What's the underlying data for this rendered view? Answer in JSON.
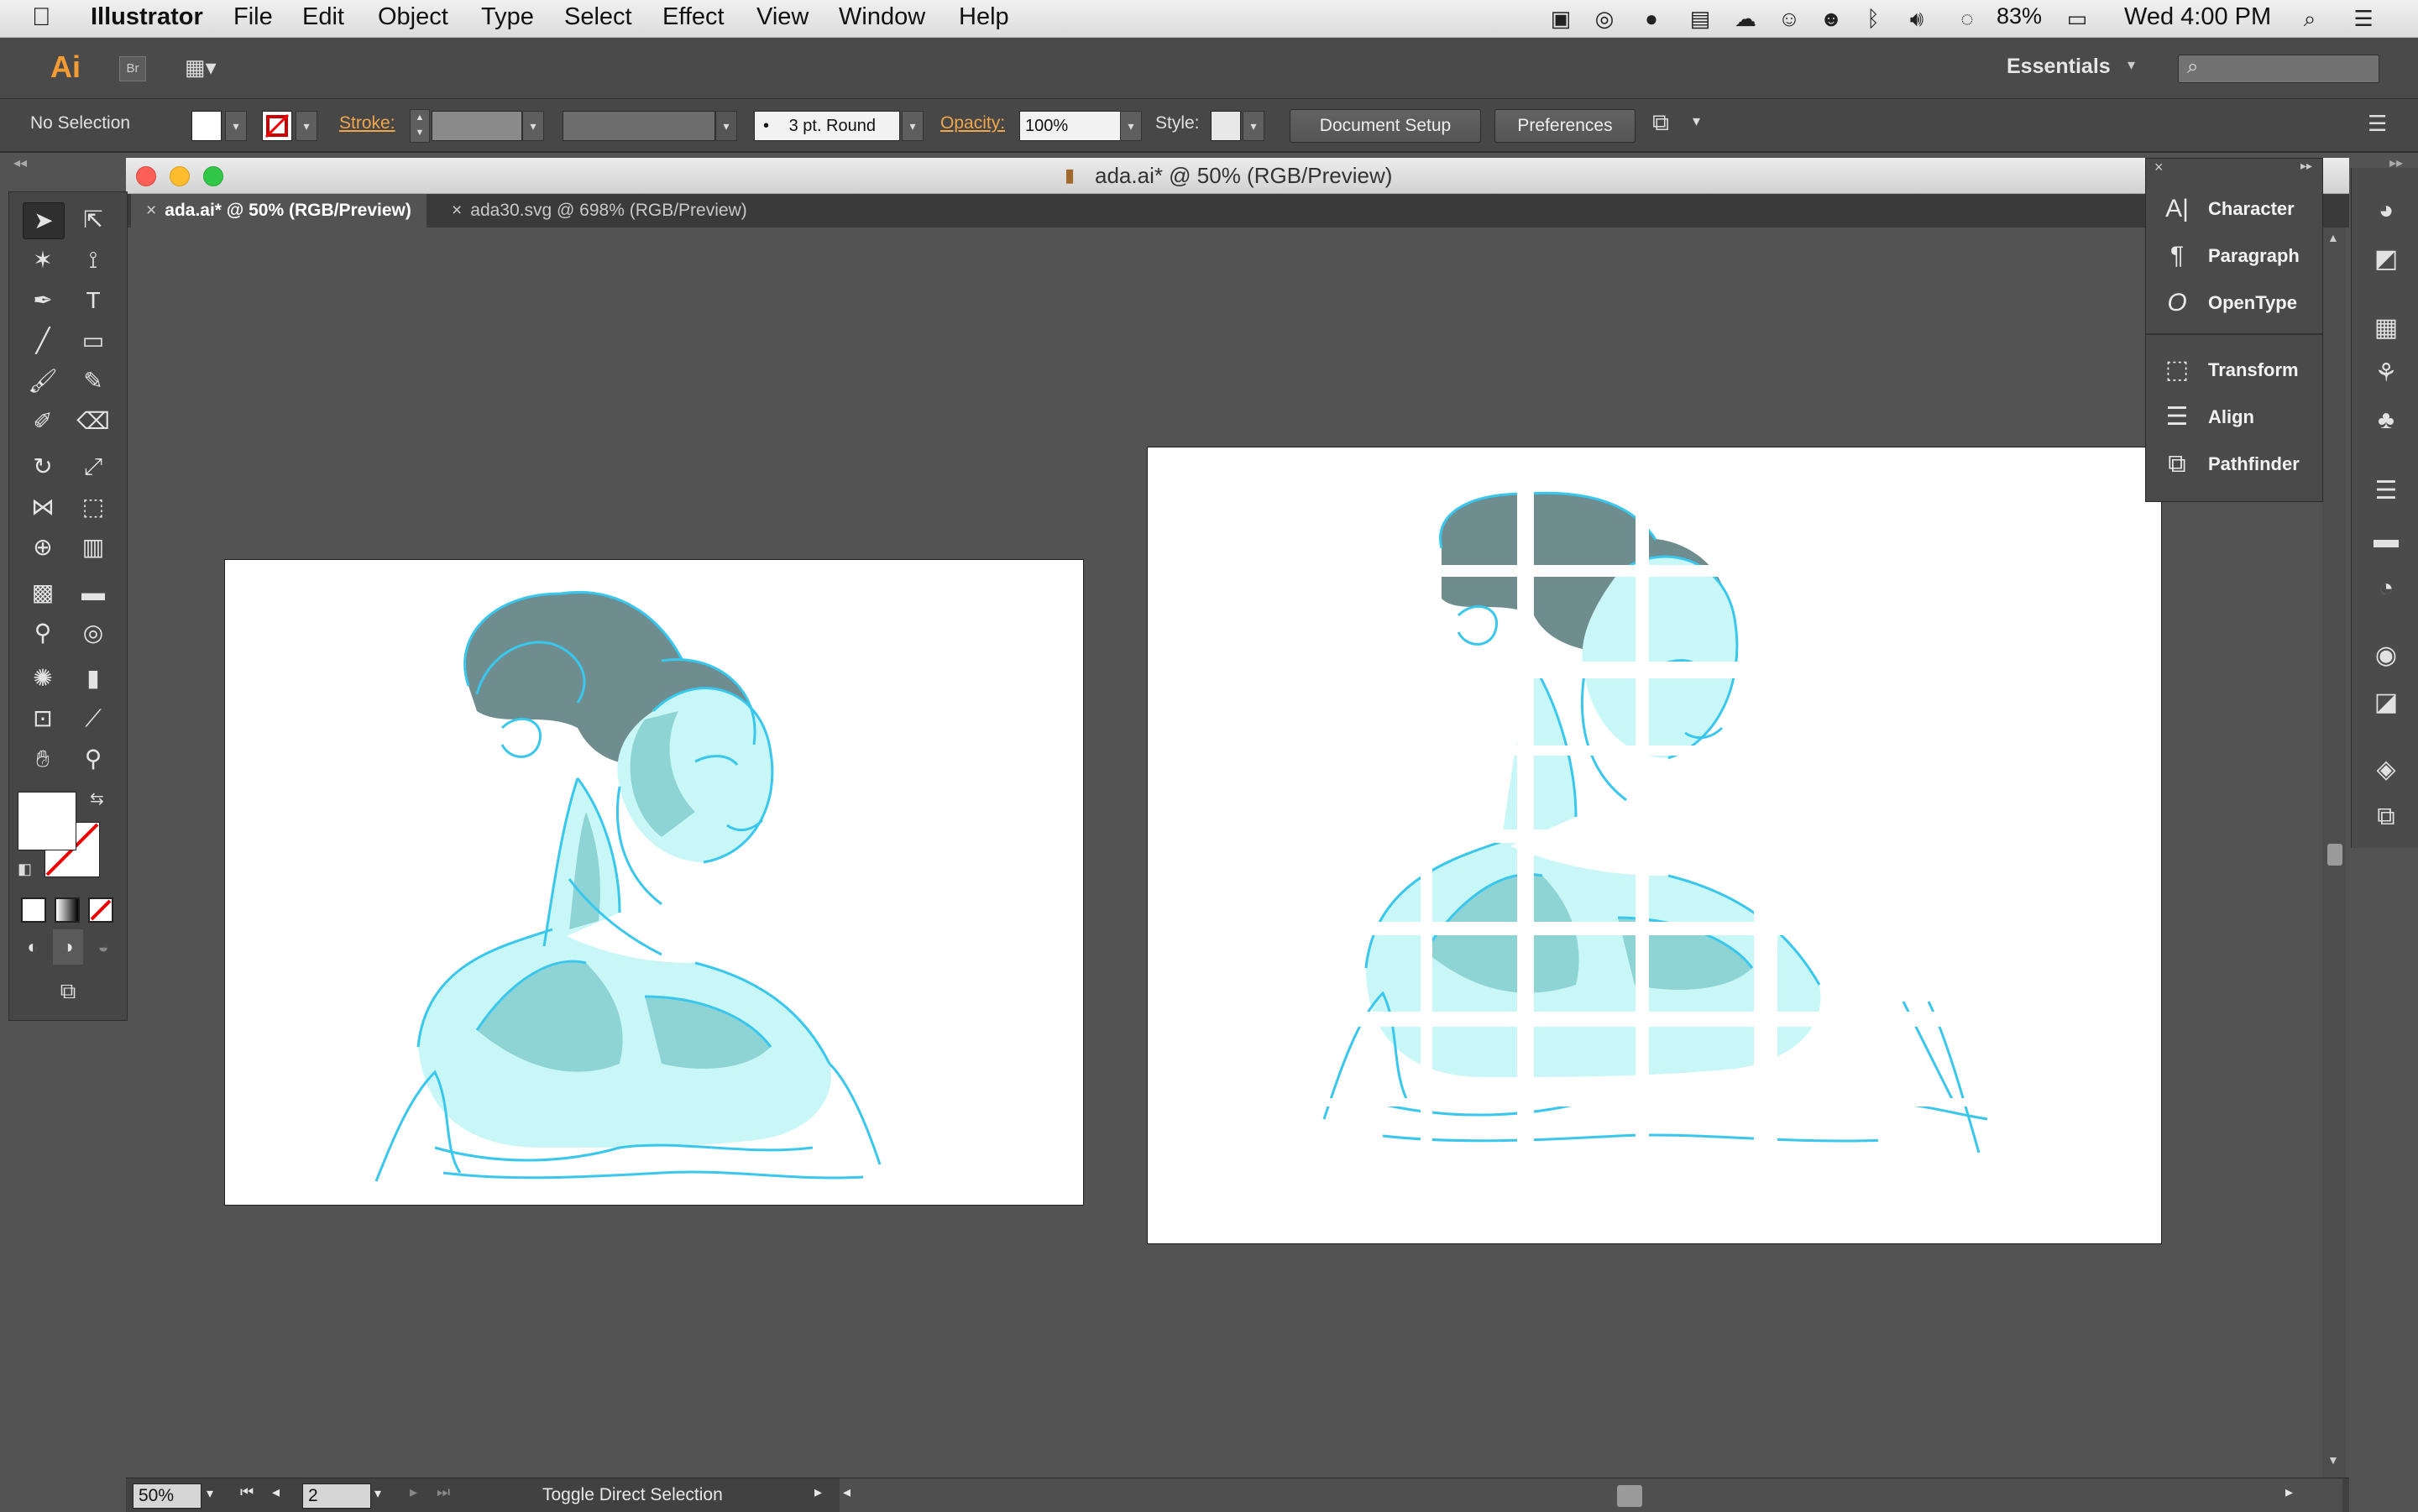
{
  "menubar": {
    "app_name": "Illustrator",
    "items": [
      "File",
      "Edit",
      "Object",
      "Type",
      "Select",
      "Effect",
      "View",
      "Window",
      "Help"
    ],
    "battery": "83%",
    "clock": "Wed 4:00 PM"
  },
  "appbar": {
    "logo": "Ai",
    "bridge": "Br",
    "workspace": "Essentials",
    "search_placeholder": ""
  },
  "controlbar": {
    "selection_status": "No Selection",
    "stroke_label": "Stroke:",
    "brush_label": "3 pt. Round",
    "opacity_label": "Opacity:",
    "opacity_value": "100%",
    "style_label": "Style:",
    "document_setup": "Document Setup",
    "preferences": "Preferences"
  },
  "window": {
    "title": "ada.ai* @ 50% (RGB/Preview)"
  },
  "tabs": [
    {
      "label": "ada.ai* @ 50% (RGB/Preview)",
      "active": true
    },
    {
      "label": "ada30.svg @ 698% (RGB/Preview)",
      "active": false
    }
  ],
  "panel_flyout": {
    "items": [
      {
        "label": "Character",
        "icon": "character-icon"
      },
      {
        "label": "Paragraph",
        "icon": "paragraph-icon"
      },
      {
        "label": "OpenType",
        "icon": "opentype-icon"
      },
      {
        "label": "Transform",
        "icon": "transform-icon"
      },
      {
        "label": "Align",
        "icon": "align-icon"
      },
      {
        "label": "Pathfinder",
        "icon": "pathfinder-icon"
      }
    ]
  },
  "statusbar": {
    "zoom": "50%",
    "artboard_number": "2",
    "tool_status": "Toggle Direct Selection"
  },
  "colors": {
    "portrait_fill_light": "#c9f7f7",
    "portrait_fill_mid": "#8fd4d4",
    "portrait_hair": "#6f8d8f",
    "portrait_stroke": "#39c7ee",
    "accent_orange": "#f0a64b"
  }
}
